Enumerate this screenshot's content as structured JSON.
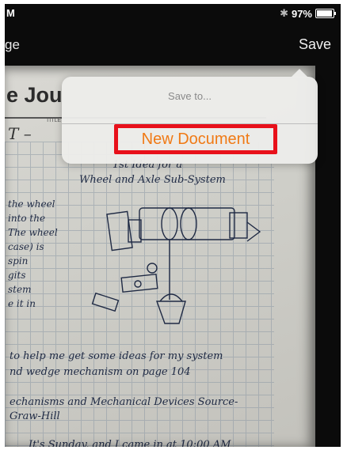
{
  "status_bar": {
    "time_fragment": "M",
    "bluetooth_icon": "bluetooth-icon",
    "battery_text": "97%",
    "battery_level": 0.97
  },
  "nav": {
    "back_label": "ge",
    "save_label": "Save"
  },
  "photo": {
    "title_text": "e Jou",
    "title_caption": "TITLE",
    "title_field": "T –",
    "sketch_heading_1": "1st Idea for a",
    "sketch_heading_2": "Wheel and Axle Sub-System",
    "left_notes": [
      "the wheel",
      "into the",
      "The wheel",
      "case) is",
      "spin",
      "gits",
      "stem",
      "e it in"
    ],
    "bottom_notes": [
      "to help me get some ideas for my system",
      "nd wedge mechanism on page 104",
      "echanisms and Mechanical Devices Source-",
      "Graw-Hill",
      "It's Sunday, and I came in at 10:00 AM"
    ]
  },
  "popover": {
    "heading": "Save to...",
    "option_label": "New Document",
    "highlight_color": "#e8101a",
    "option_color": "#f07a15"
  }
}
